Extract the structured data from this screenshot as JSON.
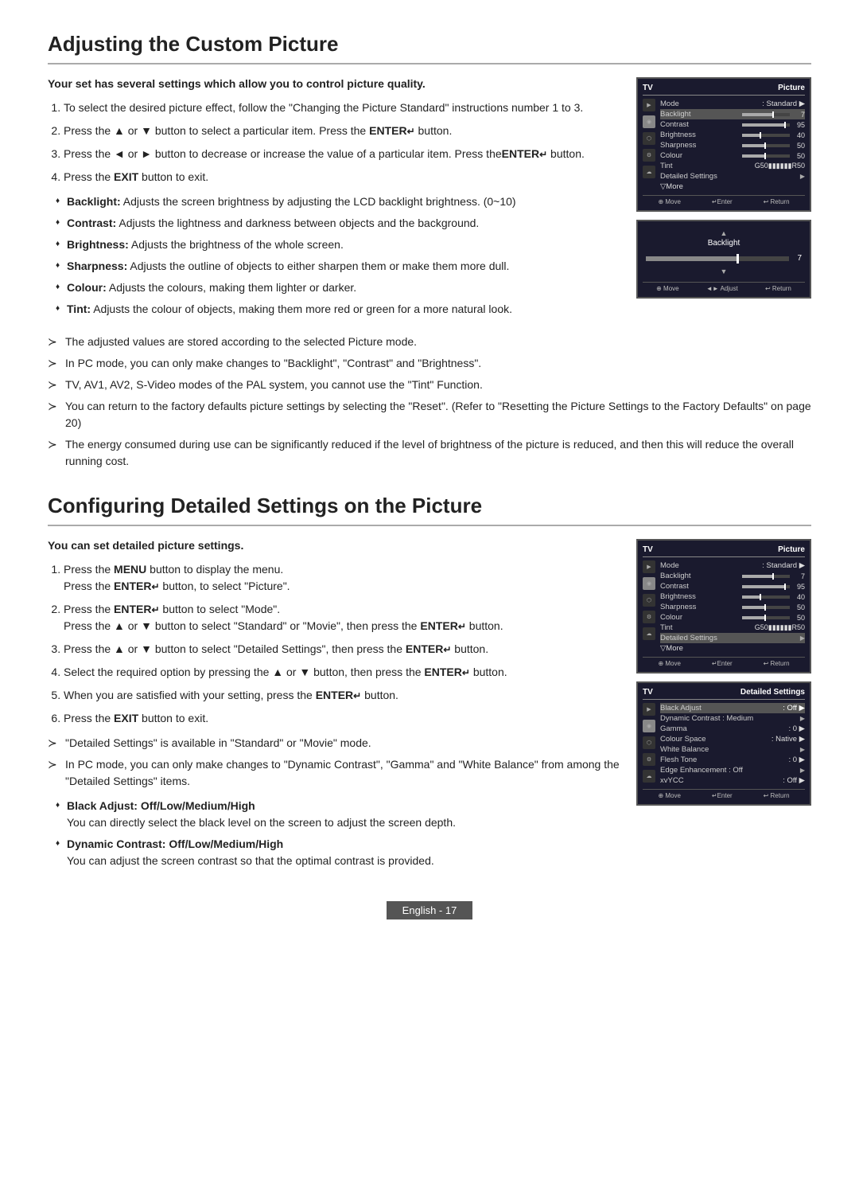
{
  "section1": {
    "title": "Adjusting the Custom Picture",
    "intro": "Your set has several settings which allow you to control picture quality.",
    "steps": [
      "To select the desired picture effect, follow the \"Changing the Picture Standard\" instructions number 1 to 3.",
      "Press the ▲ or ▼ button to select a particular item. Press the ENTER↵ button.",
      "Press the ◄ or ► button to decrease or increase the value of a particular item. Press theENTER↵ button.",
      "Press the EXIT button to exit."
    ],
    "bullets": [
      {
        "term": "Backlight:",
        "desc": "Adjusts the screen brightness by adjusting the LCD backlight brightness. (0~10)"
      },
      {
        "term": "Contrast:",
        "desc": "Adjusts the lightness and darkness between objects and the background."
      },
      {
        "term": "Brightness:",
        "desc": "Adjusts the brightness of the whole screen."
      },
      {
        "term": "Sharpness:",
        "desc": "Adjusts the outline of objects to either sharpen them or make them more dull."
      },
      {
        "term": "Colour:",
        "desc": "Adjusts the colours, making them lighter or darker."
      },
      {
        "term": "Tint:",
        "desc": "Adjusts the colour of objects, making them more red or green for a more natural look."
      }
    ],
    "notes": [
      "The adjusted values are stored according to the selected Picture mode.",
      "In PC mode, you can only make changes to \"Backlight\", \"Contrast\" and  \"Brightness\".",
      "TV, AV1, AV2, S-Video modes of the PAL system, you cannot use the \"Tint\" Function.",
      "You can return to the factory defaults picture settings by selecting the \"Reset\". (Refer to \"Resetting the Picture Settings to the Factory Defaults\" on page 20)",
      "The energy consumed during use can be significantly reduced if the level of brightness of the picture is reduced, and then this will reduce the overall running cost."
    ],
    "screen1": {
      "header_left": "TV",
      "header_right": "Picture",
      "rows": [
        {
          "label": "Mode",
          "value": ": Standard",
          "type": "arrow"
        },
        {
          "label": "Backlight",
          "value": "7",
          "type": "bar",
          "percent": 65
        },
        {
          "label": "Contrast",
          "value": "95",
          "type": "bar",
          "percent": 90
        },
        {
          "label": "Brightness",
          "value": "40",
          "type": "bar",
          "percent": 38
        },
        {
          "label": "Sharpness",
          "value": "50",
          "type": "bar",
          "percent": 48
        },
        {
          "label": "Colour",
          "value": "50",
          "type": "bar",
          "percent": 48
        },
        {
          "label": "Tint",
          "value": "",
          "type": "tint"
        },
        {
          "label": "Detailed Settings",
          "value": "",
          "type": "arrow"
        },
        {
          "label": "▽More",
          "value": "",
          "type": "plain"
        }
      ],
      "footer": [
        "⊕ Move",
        "↵Enter",
        "↩ Return"
      ]
    },
    "screen2": {
      "label": "Backlight",
      "value": "7",
      "footer": [
        "⊕ Move",
        "◄► Adjust",
        "↩ Return"
      ]
    }
  },
  "section2": {
    "title": "Configuring Detailed Settings on the Picture",
    "intro": "You can set detailed picture settings.",
    "steps": [
      {
        "text": "Press the MENU button to display the menu.\nPress the ENTER↵ button, to select \"Picture\"."
      },
      {
        "text": "Press the ENTER↵ button to select \"Mode\".\nPress the ▲ or ▼ button to select \"Standard\" or \"Movie\", then press the ENTER↵ button."
      },
      {
        "text": "Press the ▲ or ▼ button to select \"Detailed Settings\", then press the ENTER↵ button."
      },
      {
        "text": "Select the required option by pressing the ▲ or ▼ button, then press the ENTER↵ button."
      },
      {
        "text": "When you are satisfied with your setting, press the ENTER↵ button."
      },
      {
        "text": "Press the EXIT button to exit."
      }
    ],
    "notes": [
      "\"Detailed Settings\" is available in \"Standard\" or \"Movie\" mode.",
      "In PC mode, you can only make changes to \"Dynamic Contrast\", \"Gamma\" and \"White Balance\" from among the \"Detailed Settings\" items."
    ],
    "bullets2": [
      {
        "term": "Black Adjust: Off/Low/Medium/High",
        "desc": "You can directly select the black level on the screen to adjust the screen depth."
      },
      {
        "term": "Dynamic Contrast: Off/Low/Medium/High",
        "desc": "You can adjust the screen contrast so that the optimal contrast is provided."
      }
    ],
    "screen3": {
      "header_left": "TV",
      "header_right": "Picture",
      "rows": [
        {
          "label": "Mode",
          "value": ": Standard",
          "type": "arrow"
        },
        {
          "label": "Backlight",
          "value": "7",
          "type": "bar",
          "percent": 65
        },
        {
          "label": "Contrast",
          "value": "95",
          "type": "bar",
          "percent": 90
        },
        {
          "label": "Brightness",
          "value": "40",
          "type": "bar",
          "percent": 38
        },
        {
          "label": "Sharpness",
          "value": "50",
          "type": "bar",
          "percent": 48
        },
        {
          "label": "Colour",
          "value": "50",
          "type": "bar",
          "percent": 48
        },
        {
          "label": "Tint",
          "value": "",
          "type": "tint"
        },
        {
          "label": "Detailed Settings",
          "value": "",
          "type": "arrow-highlight"
        },
        {
          "label": "▽More",
          "value": "",
          "type": "plain"
        }
      ],
      "footer": [
        "⊕ Move",
        "↵Enter",
        "↩ Return"
      ]
    },
    "screen4": {
      "header": "Detailed Settings",
      "rows": [
        {
          "label": "Black Adjust",
          "value": ": Off",
          "type": "arrow"
        },
        {
          "label": "Dynamic Contrast",
          "value": ": Medium",
          "type": "arrow"
        },
        {
          "label": "Gamma",
          "value": ": 0",
          "type": "arrow"
        },
        {
          "label": "Colour Space",
          "value": ": Native",
          "type": "arrow"
        },
        {
          "label": "White Balance",
          "value": "",
          "type": "arrow"
        },
        {
          "label": "Flesh Tone",
          "value": ": 0",
          "type": "arrow"
        },
        {
          "label": "Edge Enhancement : Off",
          "value": "",
          "type": "arrow"
        },
        {
          "label": "xvYCC",
          "value": ": Off",
          "type": "arrow"
        }
      ],
      "footer": [
        "⊕ Move",
        "↵Enter",
        "↩ Return"
      ]
    }
  },
  "footer": {
    "label": "English - 17"
  }
}
